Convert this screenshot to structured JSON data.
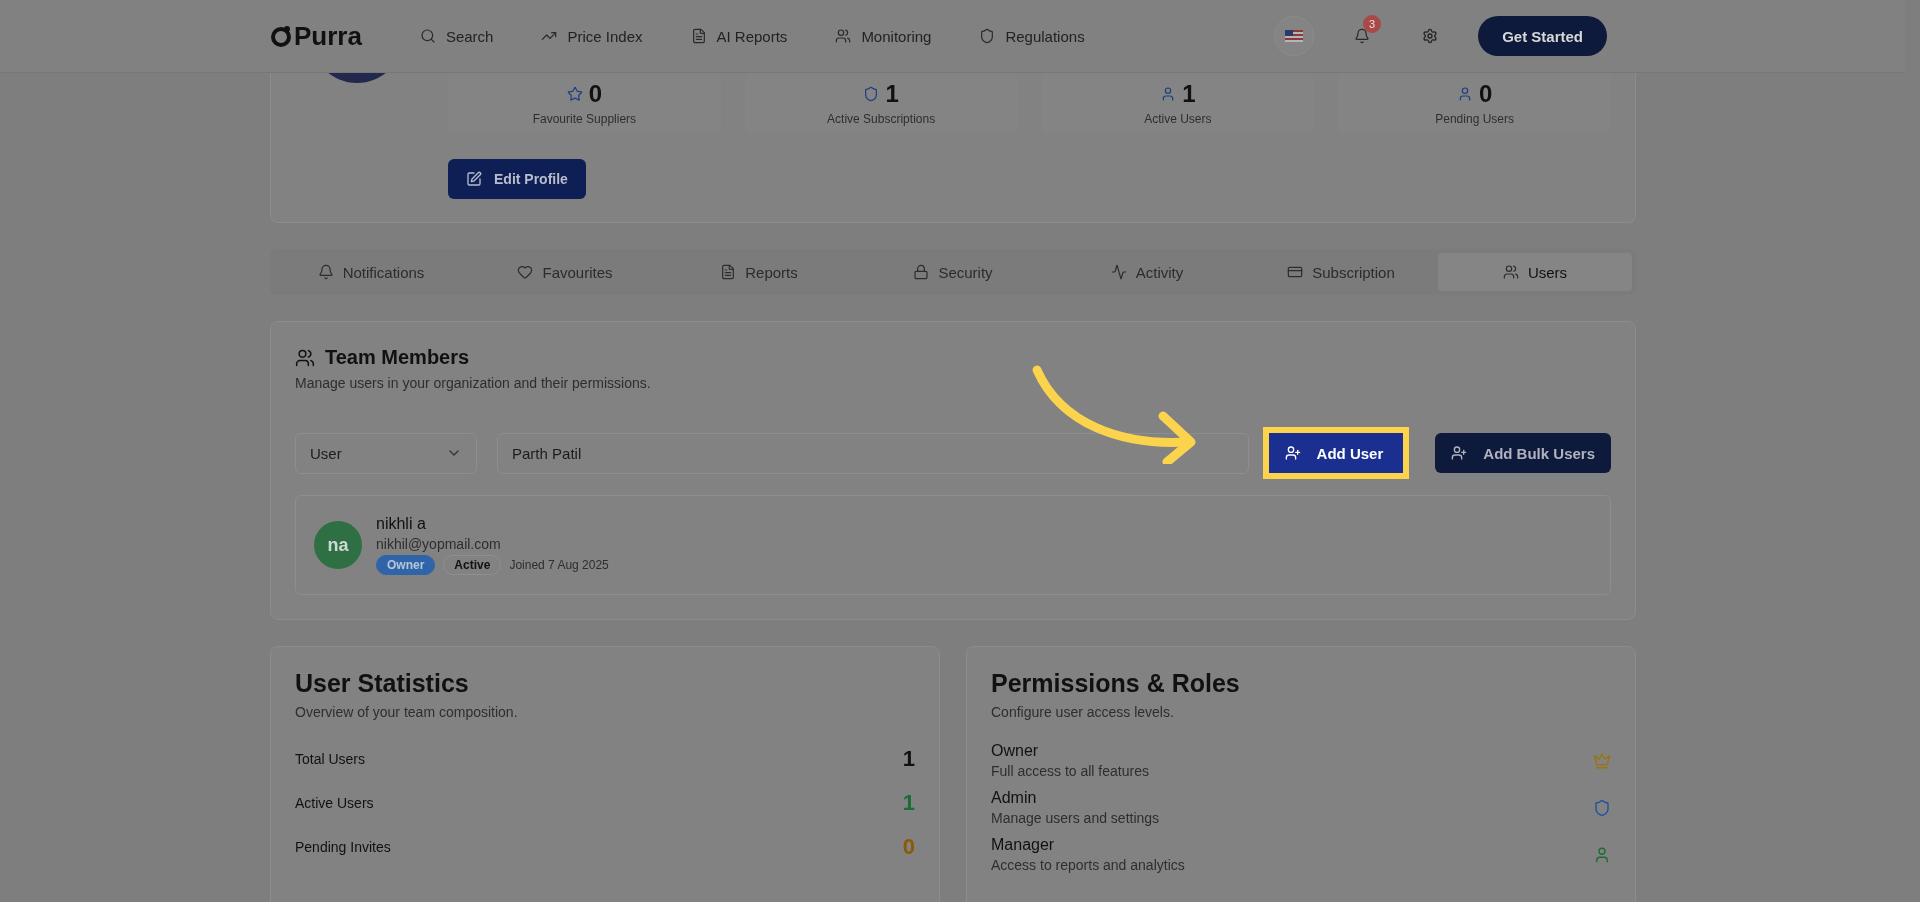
{
  "header": {
    "logo": "Purra",
    "nav": [
      {
        "label": "Search",
        "kind": "search"
      },
      {
        "label": "Price Index",
        "kind": "trend"
      },
      {
        "label": "AI Reports",
        "kind": "file"
      },
      {
        "label": "Monitoring",
        "kind": "users"
      },
      {
        "label": "Regulations",
        "kind": "shield"
      }
    ],
    "notification_count": "3",
    "cta": "Get Started"
  },
  "profile": {
    "stats": [
      {
        "value": "0",
        "label": "Favourite Suppliers",
        "kind": "star"
      },
      {
        "value": "1",
        "label": "Active Subscriptions",
        "kind": "shield"
      },
      {
        "value": "1",
        "label": "Active Users",
        "kind": "user"
      },
      {
        "value": "0",
        "label": "Pending Users",
        "kind": "user"
      }
    ],
    "edit_button": "Edit Profile"
  },
  "tabs": [
    {
      "label": "Notifications",
      "kind": "bell",
      "selected": false
    },
    {
      "label": "Favourites",
      "kind": "heart",
      "selected": false
    },
    {
      "label": "Reports",
      "kind": "file",
      "selected": false
    },
    {
      "label": "Security",
      "kind": "lock",
      "selected": false
    },
    {
      "label": "Activity",
      "kind": "activity",
      "selected": false
    },
    {
      "label": "Subscription",
      "kind": "card",
      "selected": false
    },
    {
      "label": "Users",
      "kind": "users",
      "selected": true
    }
  ],
  "team": {
    "title": "Team Members",
    "subtitle": "Manage users in your organization and their permissions.",
    "role_select": "User",
    "name_input": "Parth Patil",
    "add_user": "Add User",
    "add_bulk": "Add Bulk Users",
    "members": [
      {
        "initials": "na",
        "name": "nikhli a",
        "email": "nikhil@yopmail.com",
        "badges": [
          {
            "label": "Owner",
            "kind": "filled"
          },
          {
            "label": "Active",
            "kind": "outline"
          }
        ],
        "joined": "Joined 7 Aug 2025"
      }
    ]
  },
  "user_statistics": {
    "title": "User Statistics",
    "subtitle": "Overview of your team composition.",
    "rows": [
      {
        "label": "Total Users",
        "value": "1",
        "color": "#111111"
      },
      {
        "label": "Active Users",
        "value": "1",
        "color": "#1a6b34"
      },
      {
        "label": "Pending Invites",
        "value": "0",
        "color": "#8a5a06"
      }
    ]
  },
  "permissions": {
    "title": "Permissions & Roles",
    "subtitle": "Configure user access levels.",
    "roles": [
      {
        "name": "Owner",
        "description": "Full access to all features",
        "kind": "crown"
      },
      {
        "name": "Admin",
        "description": "Manage users and settings",
        "kind": "shield"
      },
      {
        "name": "Manager",
        "description": "Access to reports and analytics",
        "kind": "user"
      }
    ]
  }
}
